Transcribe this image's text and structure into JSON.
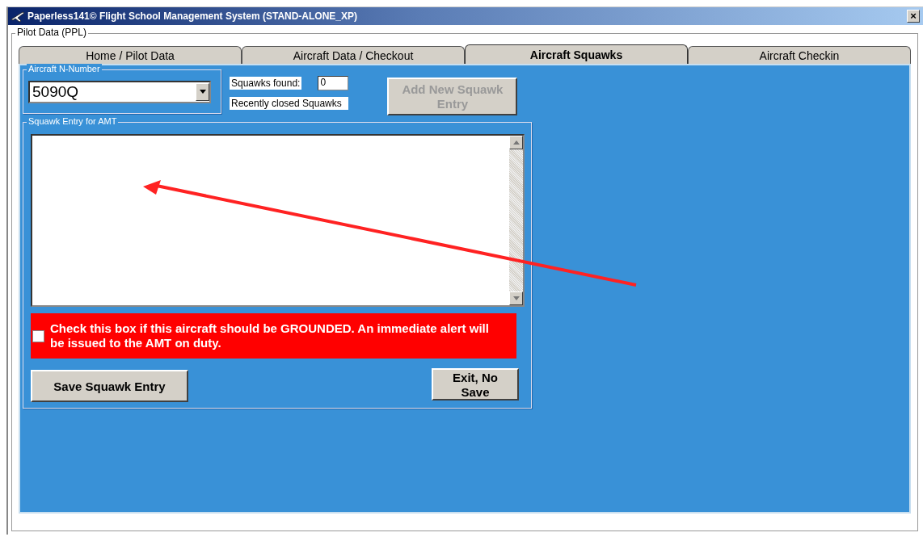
{
  "window": {
    "title": "Paperless141© Flight School Management System (STAND-ALONE_XP)",
    "close": "×"
  },
  "pilot_group": {
    "label": "Pilot Data (PPL)"
  },
  "tabs": [
    {
      "label": "Home / Pilot Data",
      "selected": false
    },
    {
      "label": "Aircraft Data / Checkout",
      "selected": false
    },
    {
      "label": "Aircraft Squawks",
      "selected": true
    },
    {
      "label": "Aircraft Checkin",
      "selected": false
    }
  ],
  "aircraft": {
    "label": "Aircraft N-Number",
    "value": "5090Q"
  },
  "squawks_found": {
    "label": "Squawks found:",
    "value": "0"
  },
  "recently_closed": "Recently closed Squawks",
  "add_button": {
    "label": "Add New Squawk Entry",
    "disabled": true
  },
  "entry": {
    "label": "Squawk Entry for AMT"
  },
  "grounded": {
    "label": "Check this box if this aircraft should be GROUNDED. An immediate alert will be issued to the AMT on duty.",
    "checked": false
  },
  "buttons": [
    {
      "label": "Save Squawk Entry",
      "kind": "save"
    },
    {
      "label": "Exit, No Save",
      "kind": "exit"
    }
  ]
}
